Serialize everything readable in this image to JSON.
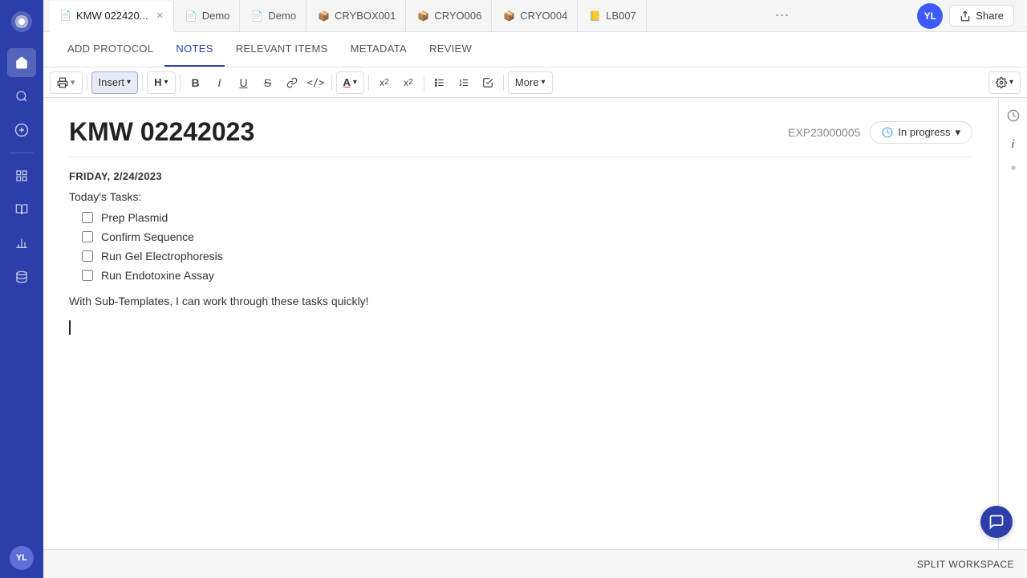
{
  "sidebar": {
    "logo_text": "🧬",
    "icons": [
      {
        "name": "home-icon",
        "symbol": "⌂"
      },
      {
        "name": "search-icon",
        "symbol": "🔍"
      },
      {
        "name": "add-icon",
        "symbol": "+"
      },
      {
        "name": "grid-icon",
        "symbol": "⊞"
      },
      {
        "name": "notebook-icon",
        "symbol": "📓"
      },
      {
        "name": "chart-icon",
        "symbol": "📊"
      },
      {
        "name": "storage-icon",
        "symbol": "🗄"
      }
    ],
    "avatar_label": "YL"
  },
  "tabs": [
    {
      "id": "kmw",
      "label": "KMW 022420...",
      "icon": "📄",
      "active": true,
      "closeable": true
    },
    {
      "id": "demo1",
      "label": "Demo",
      "icon": "📄",
      "active": false
    },
    {
      "id": "demo2",
      "label": "Demo",
      "icon": "📄",
      "active": false
    },
    {
      "id": "crybox001",
      "label": "CRYBOX001",
      "icon": "📦",
      "active": false
    },
    {
      "id": "cryo006",
      "label": "CRYO006",
      "icon": "📦",
      "active": false
    },
    {
      "id": "cryo004",
      "label": "CRYO004",
      "icon": "📦",
      "active": false
    },
    {
      "id": "lb007",
      "label": "LB007",
      "icon": "📒",
      "active": false
    }
  ],
  "tabs_more": "⋯",
  "nav": {
    "items": [
      {
        "id": "add-protocol",
        "label": "ADD PROTOCOL",
        "active": false
      },
      {
        "id": "notes",
        "label": "NOTES",
        "active": true
      },
      {
        "id": "relevant-items",
        "label": "RELEVANT ITEMS",
        "active": false
      },
      {
        "id": "metadata",
        "label": "METADATA",
        "active": false
      },
      {
        "id": "review",
        "label": "REVIEW",
        "active": false
      }
    ]
  },
  "toolbar": {
    "print_label": "🖨",
    "insert_label": "Insert",
    "insert_arrow": "▾",
    "heading_label": "H",
    "heading_arrow": "▾",
    "bold": "B",
    "italic": "I",
    "underline": "U",
    "strikethrough": "S",
    "link": "🔗",
    "code": "<>",
    "font_color": "A",
    "font_color_arrow": "▾",
    "subscript": "x₂",
    "superscript": "x²",
    "bullet_list": "≡",
    "ordered_list": "≣",
    "checklist": "☑",
    "more_label": "More",
    "more_arrow": "▾",
    "settings_icon": "⚙",
    "settings_arrow": "▾"
  },
  "header": {
    "user_avatar": "YL",
    "share_icon": "↗",
    "share_label": "Share"
  },
  "document": {
    "title": "KMW 02242023",
    "exp_id": "EXP23000005",
    "status": "In progress",
    "status_arrow": "▾",
    "date": "FRIDAY, 2/24/2023",
    "task_label": "Today's Tasks:",
    "checklist_items": [
      {
        "id": "prep-plasmid",
        "label": "Prep Plasmid",
        "checked": false
      },
      {
        "id": "confirm-seq",
        "label": "Confirm Sequence",
        "checked": false
      },
      {
        "id": "run-gel",
        "label": "Run Gel Electrophoresis",
        "checked": false
      },
      {
        "id": "run-endo",
        "label": "Run Endotoxine Assay",
        "checked": false
      }
    ],
    "body_text": "With Sub-Templates, I can work through these tasks quickly!"
  },
  "right_panel": {
    "info_icon": "ℹ",
    "clock_icon": "🕐",
    "circle_icon": "●"
  },
  "bottom_bar": {
    "split_workspace": "SPLIT WORKSPACE"
  },
  "chat": {
    "icon": "💬"
  }
}
